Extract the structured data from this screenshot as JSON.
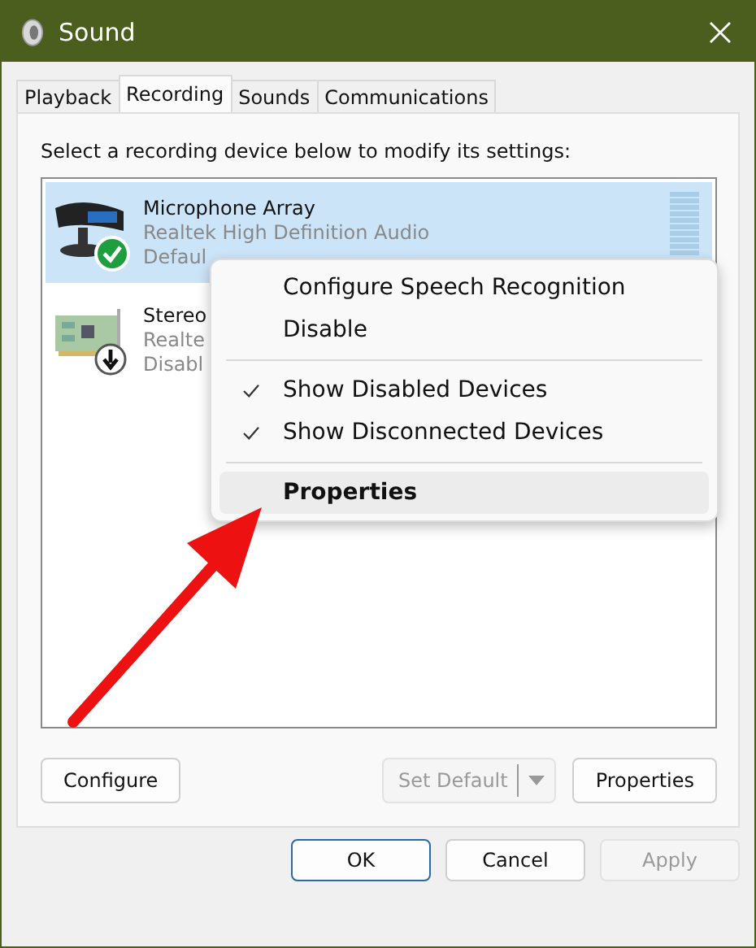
{
  "window": {
    "title": "Sound"
  },
  "tabs": [
    {
      "label": "Playback",
      "selected": false
    },
    {
      "label": "Recording",
      "selected": true
    },
    {
      "label": "Sounds",
      "selected": false
    },
    {
      "label": "Communications",
      "selected": false
    }
  ],
  "description": "Select a recording device below to modify its settings:",
  "devices": [
    {
      "kind": "microphone",
      "name": "Microphone Array",
      "driver": "Realtek High Definition Audio",
      "status": "Defaul",
      "default_device": true,
      "disabled": false,
      "selected": true
    },
    {
      "kind": "card",
      "name": "Stereo",
      "driver": "Realte",
      "status": "Disabl",
      "default_device": false,
      "disabled": true,
      "selected": false
    }
  ],
  "context_menu": [
    {
      "kind": "item",
      "label": "Configure Speech Recognition",
      "checked": false,
      "bold": false,
      "selected": false
    },
    {
      "kind": "item",
      "label": "Disable",
      "checked": false,
      "bold": false,
      "selected": false
    },
    {
      "kind": "separator"
    },
    {
      "kind": "item",
      "label": "Show Disabled Devices",
      "checked": true,
      "bold": false,
      "selected": false
    },
    {
      "kind": "item",
      "label": "Show Disconnected Devices",
      "checked": true,
      "bold": false,
      "selected": false
    },
    {
      "kind": "separator"
    },
    {
      "kind": "item",
      "label": "Properties",
      "checked": false,
      "bold": true,
      "selected": true
    }
  ],
  "panel_buttons": {
    "configure": {
      "label": "Configure",
      "disabled": false
    },
    "set_default": {
      "label": "Set Default",
      "disabled": true
    },
    "properties": {
      "label": "Properties",
      "disabled": false
    }
  },
  "dialog_buttons": [
    {
      "label": "OK",
      "disabled": false,
      "focused": true
    },
    {
      "label": "Cancel",
      "disabled": false,
      "focused": false
    },
    {
      "label": "Apply",
      "disabled": true,
      "focused": false
    }
  ]
}
